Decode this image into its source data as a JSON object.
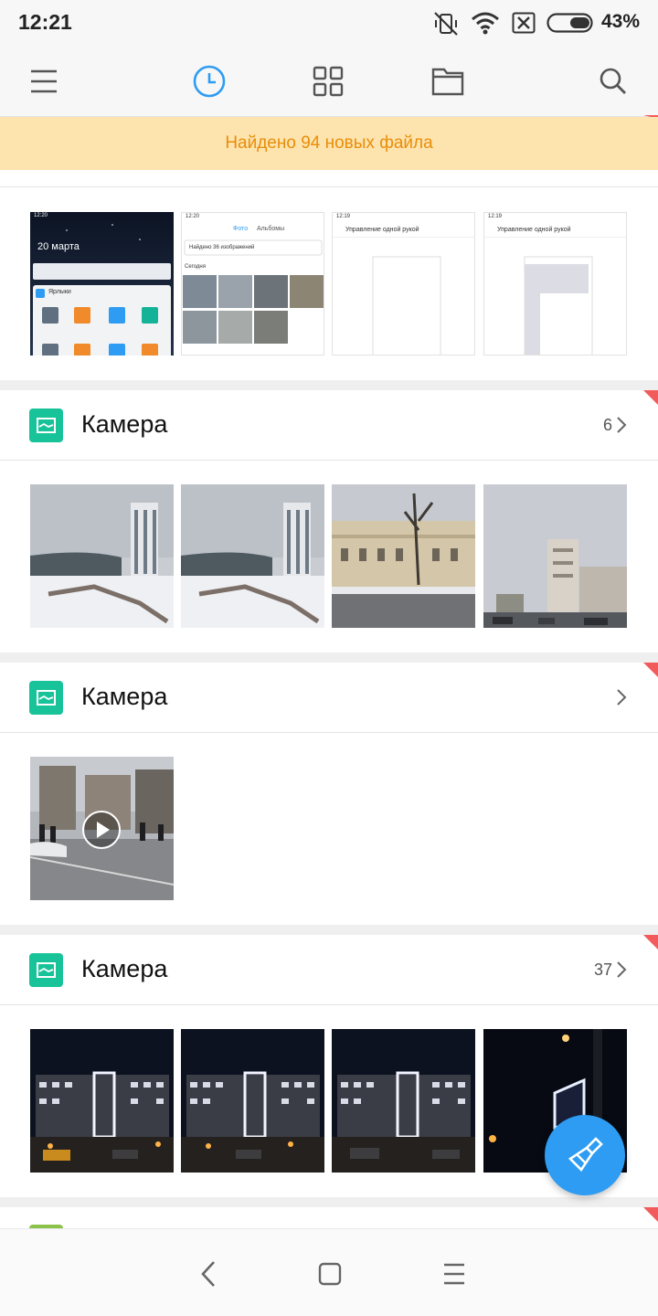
{
  "status_bar": {
    "time": "12:21",
    "battery": "43%"
  },
  "toolbar": {
    "icons": [
      "menu-icon",
      "recent-clock-icon",
      "categories-grid-icon",
      "folder-icon",
      "search-icon"
    ],
    "accent_color": "#2e9cf2"
  },
  "banner": {
    "text": "Найдено 94 новых файла"
  },
  "screenshot_thumbs": [
    {
      "date": "20 марта",
      "time": "12:20",
      "app_folder": "Ярлыки"
    },
    {
      "time": "12:20",
      "tab_photos": "Фото",
      "tab_albums": "Альбомы",
      "search_text": "Найдено 36 изображений",
      "label": "Сегодня"
    },
    {
      "time": "12:19",
      "title": "Управление одной рукой"
    },
    {
      "time": "12:19",
      "title": "Управление одной рукой"
    }
  ],
  "sections": [
    {
      "title": "Камера",
      "count": "6",
      "thumbs": [
        "snow-stadium-tower",
        "snow-stadium-tower",
        "historic-building-street",
        "tall-building-avenue"
      ]
    },
    {
      "title": "Камера",
      "count": "",
      "thumbs": [
        "street-video"
      ]
    },
    {
      "title": "Камера",
      "count": "37",
      "thumbs": [
        "night-lit-building",
        "night-lit-building",
        "night-lit-building",
        "night-lit-sign"
      ]
    }
  ],
  "colors": {
    "banner_bg": "#fde3ad",
    "banner_text": "#e88e0b",
    "section_icon": "#18c39a",
    "fab": "#2e9cf2",
    "new_marker": "#f15b5b"
  }
}
